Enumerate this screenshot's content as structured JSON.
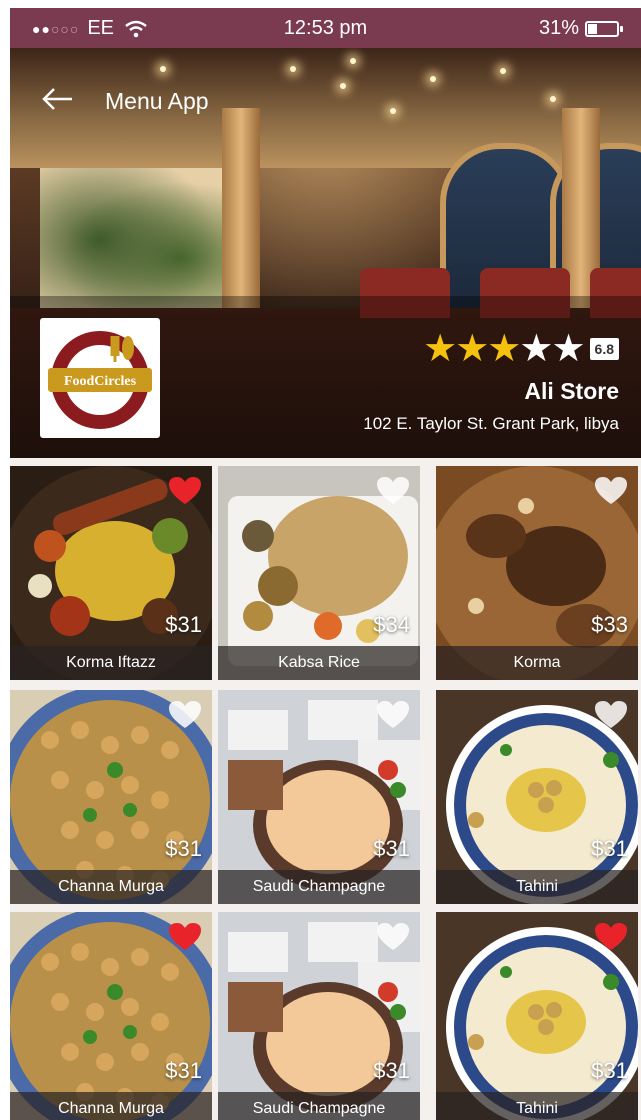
{
  "status_bar": {
    "carrier": "EE",
    "time": "12:53 pm",
    "battery": "31%",
    "battery_level": 0.31,
    "signal_bars": 2,
    "signal_total": 5
  },
  "header": {
    "title": "Menu App",
    "back_icon": "back-arrow-icon"
  },
  "store": {
    "logo_text": "FoodCircles",
    "rating_stars": 3,
    "rating_max": 5,
    "score": "6.8",
    "name": "Ali Store",
    "address": "102 E. Taylor St. Grant Park, libya"
  },
  "colors": {
    "status_bar": "#7a3a4f",
    "star": "#f4c20d",
    "heart_active": "#e8242a",
    "heart_inactive": "#ffffff",
    "logo_ring": "#8b1b1f",
    "logo_banner": "#c99a1d"
  },
  "menu": {
    "items": [
      {
        "name": "Korma Iftazz",
        "price": "$31",
        "favorite": true,
        "photo": "mixed-grill"
      },
      {
        "name": "Kabsa Rice",
        "price": "$34",
        "favorite": false,
        "photo": "kabsa"
      },
      {
        "name": "Korma",
        "price": "$33",
        "favorite": false,
        "photo": "korma"
      },
      {
        "name": "Channa Murga",
        "price": "$31",
        "favorite": false,
        "photo": "chickpeas"
      },
      {
        "name": "Saudi Champagne",
        "price": "$31",
        "favorite": false,
        "photo": "buffet"
      },
      {
        "name": "Tahini",
        "price": "$31",
        "favorite": false,
        "photo": "hummus"
      },
      {
        "name": "Channa Murga",
        "price": "$31",
        "favorite": true,
        "photo": "chickpeas"
      },
      {
        "name": "Saudi Champagne",
        "price": "$31",
        "favorite": false,
        "photo": "buffet"
      },
      {
        "name": "Tahini",
        "price": "$31",
        "favorite": true,
        "photo": "hummus"
      }
    ]
  }
}
